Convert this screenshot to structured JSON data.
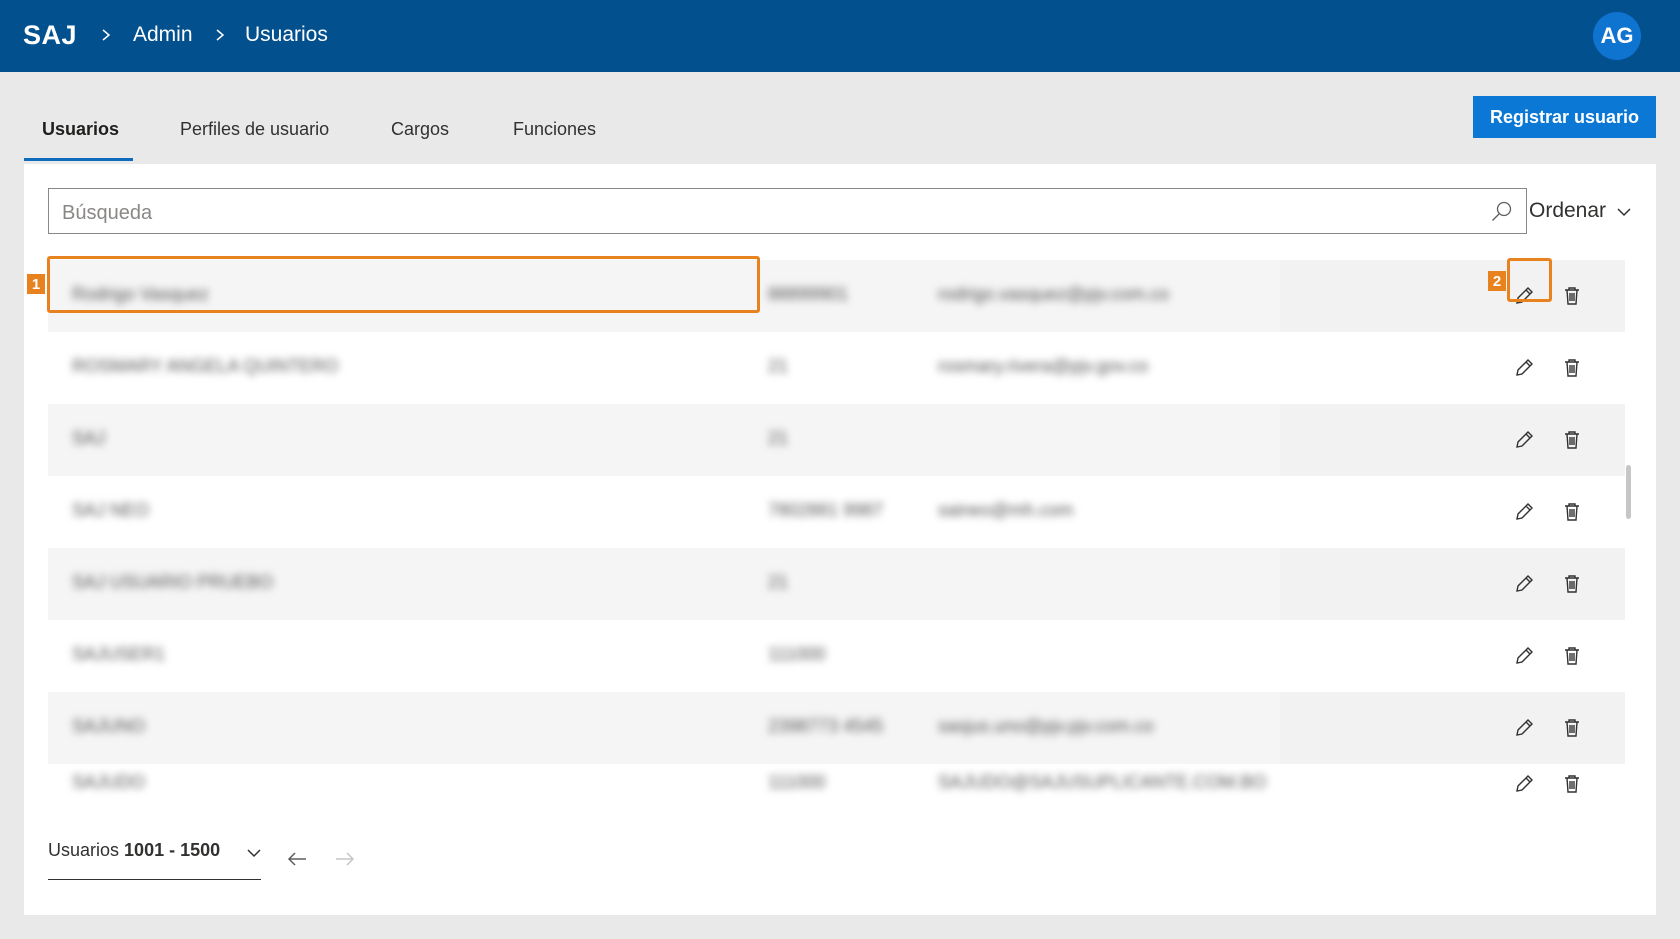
{
  "header": {
    "brand": "SAJ",
    "breadcrumb": [
      "Admin",
      "Usuarios"
    ],
    "avatar_initials": "AG"
  },
  "tabs": [
    "Usuarios",
    "Perfiles de usuario",
    "Cargos",
    "Funciones"
  ],
  "active_tab": "Usuarios",
  "register_button": "Registrar usuario",
  "search": {
    "placeholder": "Búsqueda",
    "value": ""
  },
  "sort_label": "Ordenar",
  "rows": [
    {
      "name": "Rodrigo Vasquez",
      "id": "88899901",
      "email": "rodrigo.vasquez@pjv.com.co"
    },
    {
      "name": "ROSMARY ANGELA QUINTERO",
      "id": "21",
      "email": "rosmary.rivera@pjv.gov.co"
    },
    {
      "name": "SAJ",
      "id": "21",
      "email": ""
    },
    {
      "name": "SAJ NEO",
      "id": "7802881 9987",
      "email": "saineo@mh.com"
    },
    {
      "name": "SAJ USUARIO PRUEBO",
      "id": "21",
      "email": ""
    },
    {
      "name": "SAJUSER1",
      "id": "111000",
      "email": ""
    },
    {
      "name": "SAJUNO",
      "id": "2398773 4545",
      "email": "sasjus.uno@pjv.pjv.com.co"
    },
    {
      "name": "SAJUDO",
      "id": "111000",
      "email": "SAJUDO@SAJUSUPLICANTE.COM.BO"
    }
  ],
  "annotations": {
    "badge_1": "1",
    "badge_2": "2"
  },
  "pager": {
    "prefix": "Usuarios",
    "range": "1001 - 1500"
  },
  "colors": {
    "header_bg": "#03508f",
    "accent": "#0a78d4",
    "highlight": "#e8821f"
  }
}
